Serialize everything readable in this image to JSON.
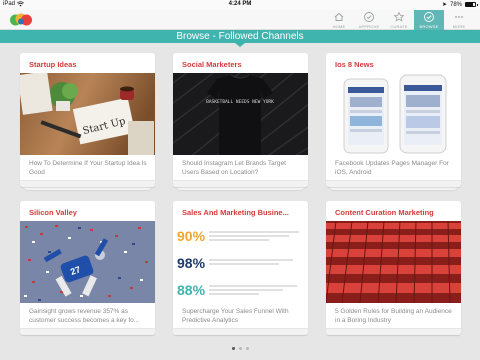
{
  "status_bar": {
    "device": "iPad",
    "time": "4:24 PM",
    "battery": "78%"
  },
  "nav": {
    "items": [
      {
        "label": "HOME",
        "icon": "home-icon",
        "active": false
      },
      {
        "label": "APPROVE",
        "icon": "check-circle-icon",
        "active": false
      },
      {
        "label": "CURATE",
        "icon": "star-icon",
        "active": false
      },
      {
        "label": "BROWSE",
        "icon": "compass-icon",
        "active": true
      },
      {
        "label": "MORE",
        "icon": "more-dots-icon",
        "active": false
      }
    ]
  },
  "banner": {
    "title": "Browse - Followed Channels"
  },
  "cards": [
    {
      "title": "Startup Ideas",
      "caption": "How To Determine If Your Startup Idea Is Good"
    },
    {
      "title": "Social Marketers",
      "caption": "Should Instagram Let Brands Target Users Based on Location?"
    },
    {
      "title": "Ios 8 News",
      "caption": "Facebook Updates Pages Manager For iOS, Android"
    },
    {
      "title": "Silicon Valley",
      "caption": "Gainsight grows revenue 357% as customer success becomes a key fo..."
    },
    {
      "title": "Sales And Marketing Busine...",
      "caption": "Supercharge Your Sales Funnel With Predictive Analytics"
    },
    {
      "title": "Content Curation Marketing",
      "caption": "5 Golden Rules for Building an Audience in a Boring Industry"
    }
  ],
  "image_text": {
    "startup_note": "Start Up",
    "tshirt": "BASKETBALL NEEDS NEW YORK",
    "stats": [
      {
        "value": "90%",
        "color": "#f2a532"
      },
      {
        "value": "98%",
        "color": "#1c3b6e"
      },
      {
        "value": "88%",
        "color": "#3fb3ad"
      }
    ]
  },
  "pagination": {
    "pages": 3,
    "current": 0
  },
  "colors": {
    "accent": "#3fb3ad",
    "card_title": "#d63a3a",
    "caption": "#8b8b8b"
  }
}
